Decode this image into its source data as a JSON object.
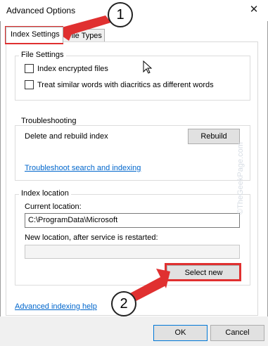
{
  "window": {
    "title": "Advanced Options",
    "close_glyph": "✕"
  },
  "tabs": [
    {
      "label": "Index Settings",
      "active": true
    },
    {
      "label": "File Types",
      "active": false
    }
  ],
  "file_settings": {
    "label": "File Settings",
    "options": [
      {
        "label": "Index encrypted files",
        "checked": false
      },
      {
        "label": "Treat similar words with diacritics as different words",
        "checked": false
      }
    ]
  },
  "troubleshooting": {
    "label": "Troubleshooting",
    "delete_rebuild_text": "Delete and rebuild index",
    "rebuild_button": "Rebuild",
    "troubleshoot_link": "Troubleshoot search and indexing"
  },
  "index_location": {
    "label": "Index location",
    "current_label": "Current location:",
    "current_value": "C:\\ProgramData\\Microsoft",
    "new_label": "New location, after service is restarted:",
    "new_value": "",
    "select_new_button": "Select new"
  },
  "advanced_help_link": "Advanced indexing help",
  "footer": {
    "ok": "OK",
    "cancel": "Cancel"
  },
  "annotations": {
    "marker1": "1",
    "marker2": "2",
    "accent_color": "#e03030"
  },
  "watermark": "©TheGeekPage.com"
}
